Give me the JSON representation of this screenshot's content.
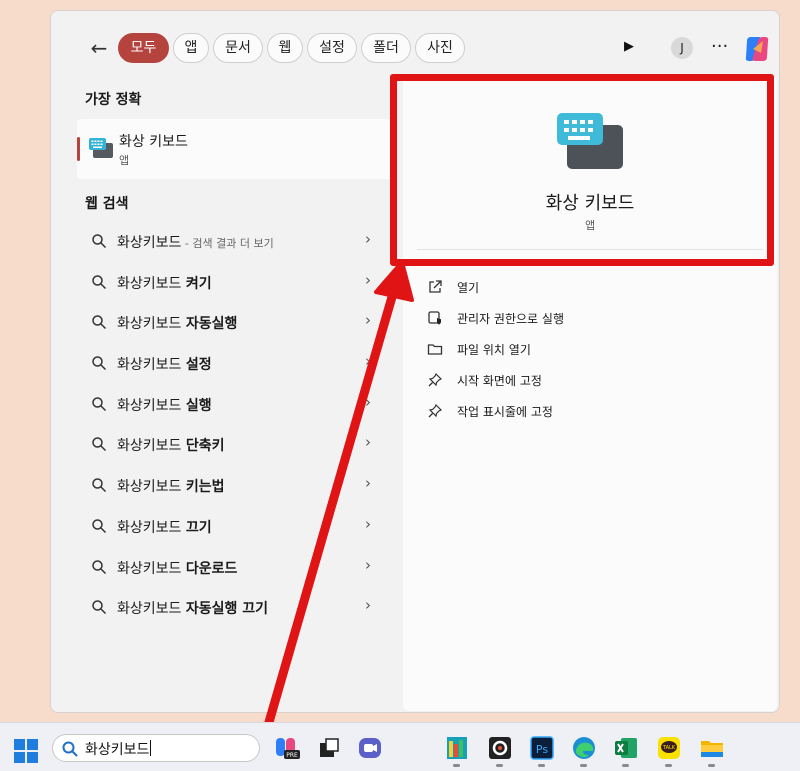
{
  "tabs": [
    {
      "label": "모두",
      "active": true
    },
    {
      "label": "앱"
    },
    {
      "label": "문서"
    },
    {
      "label": "웹"
    },
    {
      "label": "설정"
    },
    {
      "label": "폴더"
    },
    {
      "label": "사진"
    }
  ],
  "header": {
    "avatar_initial": "J",
    "more_label": "···"
  },
  "best_match": {
    "heading": "가장 정확",
    "title": "화상 키보드",
    "subtitle": "앱"
  },
  "web_search": {
    "heading": "웹 검색",
    "query": "화상키보드",
    "items": [
      {
        "prefix": "화상키보드",
        "bold": "",
        "suffix": " - 검색 결과 더 보기"
      },
      {
        "prefix": "화상키보드 ",
        "bold": "켜기",
        "suffix": ""
      },
      {
        "prefix": "화상키보드 ",
        "bold": "자동실행",
        "suffix": ""
      },
      {
        "prefix": "화상키보드 ",
        "bold": "설정",
        "suffix": ""
      },
      {
        "prefix": "화상키보드 ",
        "bold": "실행",
        "suffix": ""
      },
      {
        "prefix": "화상키보드 ",
        "bold": "단축키",
        "suffix": ""
      },
      {
        "prefix": "화상키보드 ",
        "bold": "키는법",
        "suffix": ""
      },
      {
        "prefix": "화상키보드 ",
        "bold": "끄기",
        "suffix": ""
      },
      {
        "prefix": "화상키보드 ",
        "bold": "다운로드",
        "suffix": ""
      },
      {
        "prefix": "화상키보드 ",
        "bold": "자동실행 끄기",
        "suffix": ""
      }
    ]
  },
  "preview": {
    "title": "화상 키보드",
    "subtitle": "앱",
    "actions": [
      {
        "label": "열기",
        "icon": "open-external-icon"
      },
      {
        "label": "관리자 권한으로 실행",
        "icon": "run-as-admin-icon"
      },
      {
        "label": "파일 위치 열기",
        "icon": "folder-icon"
      },
      {
        "label": "시작 화면에 고정",
        "icon": "pin-icon"
      },
      {
        "label": "작업 표시줄에 고정",
        "icon": "pin-icon"
      }
    ]
  },
  "taskbar": {
    "search_value": "화상키보드",
    "apps": [
      "copilot-pre-icon",
      "task-view-icon",
      "chat-icon",
      "app-icon",
      "app-icon",
      "photoshop-icon",
      "edge-icon",
      "excel-icon",
      "kakaotalk-icon",
      "file-explorer-icon"
    ],
    "photoshop_label": "Ps",
    "kakao_label": "TALK"
  },
  "colors": {
    "accent": "#b5443f",
    "highlight": "#e01414",
    "arrow": "#e01414"
  }
}
